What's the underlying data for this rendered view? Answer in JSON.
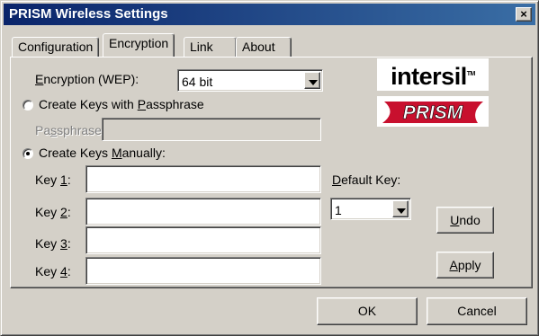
{
  "window": {
    "title": "PRISM Wireless Settings",
    "close_label": "×"
  },
  "tabs": [
    {
      "label": "Configuration",
      "active": false
    },
    {
      "label": "Encryption",
      "active": true
    },
    {
      "label": "Link",
      "active": false
    },
    {
      "label": "About",
      "active": false
    }
  ],
  "encryption": {
    "label_pre": "",
    "label_u": "E",
    "label_post": "ncryption (WEP):",
    "value": "64 bit"
  },
  "passphrase_radio": {
    "pre": "Create Keys with ",
    "u": "P",
    "post": "assphrase",
    "checked": false
  },
  "passphrase": {
    "pre": "Pa",
    "u": "s",
    "post": "sphrase:",
    "value": "",
    "enabled": false
  },
  "manual_radio": {
    "pre": "Create Keys ",
    "u": "M",
    "post": "anually:",
    "checked": true
  },
  "keys": [
    {
      "pre": "Key ",
      "u": "1",
      "post": ":",
      "value": ""
    },
    {
      "pre": "Key ",
      "u": "2",
      "post": ":",
      "value": ""
    },
    {
      "pre": "Key ",
      "u": "3",
      "post": ":",
      "value": ""
    },
    {
      "pre": "Key ",
      "u": "4",
      "post": ":",
      "value": ""
    }
  ],
  "default_key": {
    "pre": "",
    "u": "D",
    "post": "efault Key:",
    "value": "1"
  },
  "buttons": {
    "undo": {
      "u": "U",
      "post": "ndo"
    },
    "apply": {
      "u": "A",
      "post": "pply"
    },
    "ok": "OK",
    "cancel": "Cancel"
  },
  "logos": {
    "intersil_text": "intersil",
    "intersil_tm": "TM",
    "intersil_color": "#000000",
    "prism_text": "PRISM",
    "prism_color": "#c8102e"
  }
}
